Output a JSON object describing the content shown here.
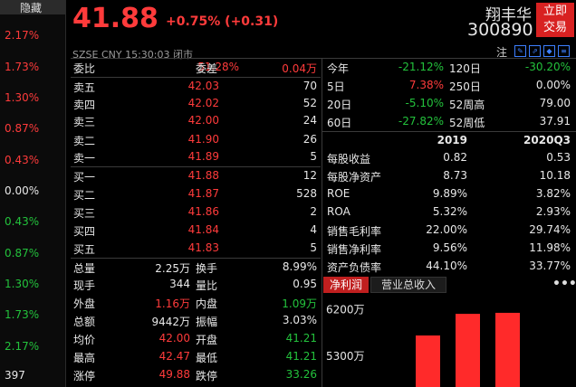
{
  "left_strip": {
    "hide_label": "隐藏",
    "values": [
      "2.17%",
      "1.73%",
      "1.30%",
      "0.87%",
      "0.43%",
      "0.00%",
      "0.43%",
      "0.87%",
      "1.30%",
      "1.73%",
      "2.17%",
      "397"
    ]
  },
  "header": {
    "price": "41.88",
    "change": "+0.75% (+0.31)",
    "name": "翔丰华",
    "code": "300890",
    "trade_btn_line1": "立即",
    "trade_btn_line2": "交易",
    "meta": "SZSE  CNY  15:30:03  闭市",
    "note": "注"
  },
  "order_book": {
    "weibi_label": "委比",
    "weibi_value": "51.28%",
    "weicha_label": "委差",
    "weicha_value": "0.04万",
    "asks": [
      {
        "label": "卖五",
        "price": "42.03",
        "vol": "70"
      },
      {
        "label": "卖四",
        "price": "42.02",
        "vol": "52"
      },
      {
        "label": "卖三",
        "price": "42.00",
        "vol": "24"
      },
      {
        "label": "卖二",
        "price": "41.90",
        "vol": "26"
      },
      {
        "label": "卖一",
        "price": "41.89",
        "vol": "5"
      }
    ],
    "bids": [
      {
        "label": "买一",
        "price": "41.88",
        "vol": "12"
      },
      {
        "label": "买二",
        "price": "41.87",
        "vol": "528"
      },
      {
        "label": "买三",
        "price": "41.86",
        "vol": "2"
      },
      {
        "label": "买四",
        "price": "41.84",
        "vol": "4"
      },
      {
        "label": "买五",
        "price": "41.83",
        "vol": "5"
      }
    ]
  },
  "stats": [
    {
      "l1": "总量",
      "v1": "2.25万",
      "l2": "换手",
      "v2": "8.99%"
    },
    {
      "l1": "现手",
      "v1": "344",
      "l2": "量比",
      "v2": "0.95"
    },
    {
      "l1": "外盘",
      "v1": "1.16万",
      "l2": "内盘",
      "v2": "1.09万"
    },
    {
      "l1": "总额",
      "v1": "9442万",
      "l2": "振幅",
      "v2": "3.03%"
    },
    {
      "l1": "均价",
      "v1": "42.00",
      "l2": "开盘",
      "v2": "41.21"
    },
    {
      "l1": "最高",
      "v1": "42.47",
      "l2": "最低",
      "v2": "41.21"
    },
    {
      "l1": "涨停",
      "v1": "49.88",
      "l2": "跌停",
      "v2": "33.26"
    }
  ],
  "performance": [
    {
      "l1": "今年",
      "v1": "-21.12%",
      "l2": "120日",
      "v2": "-30.20%"
    },
    {
      "l1": "5日",
      "v1": "7.38%",
      "l2": "250日",
      "v2": "0.00%"
    },
    {
      "l1": "20日",
      "v1": "-5.10%",
      "l2": "52周高",
      "v2": "79.00"
    },
    {
      "l1": "60日",
      "v1": "-27.82%",
      "l2": "52周低",
      "v2": "37.91"
    }
  ],
  "financials": {
    "col1": "2019",
    "col2": "2020Q3",
    "rows": [
      {
        "label": "每股收益",
        "a": "0.82",
        "b": "0.53"
      },
      {
        "label": "每股净资产",
        "a": "8.73",
        "b": "10.18"
      },
      {
        "label": "ROE",
        "a": "9.89%",
        "b": "3.82%"
      },
      {
        "label": "ROA",
        "a": "5.32%",
        "b": "2.93%"
      },
      {
        "label": "销售毛利率",
        "a": "22.00%",
        "b": "29.74%"
      },
      {
        "label": "销售净利率",
        "a": "9.56%",
        "b": "11.98%"
      },
      {
        "label": "资产负债率",
        "a": "44.10%",
        "b": "33.77%"
      }
    ]
  },
  "chart_tabs": {
    "profit": "净利润",
    "revenue": "营业总收入",
    "more": "•••"
  },
  "chart_data": {
    "type": "bar",
    "ytick_labels": [
      "6200万",
      "5300万"
    ],
    "ytick_values": [
      6200,
      5300
    ],
    "ylim": [
      4700,
      6350
    ],
    "values": [
      5700,
      6120,
      6140
    ],
    "bar_color": "#ff2a2a"
  },
  "colors": {
    "up": "#ff3b3b",
    "down": "#23c23c",
    "accent": "#d82121"
  }
}
